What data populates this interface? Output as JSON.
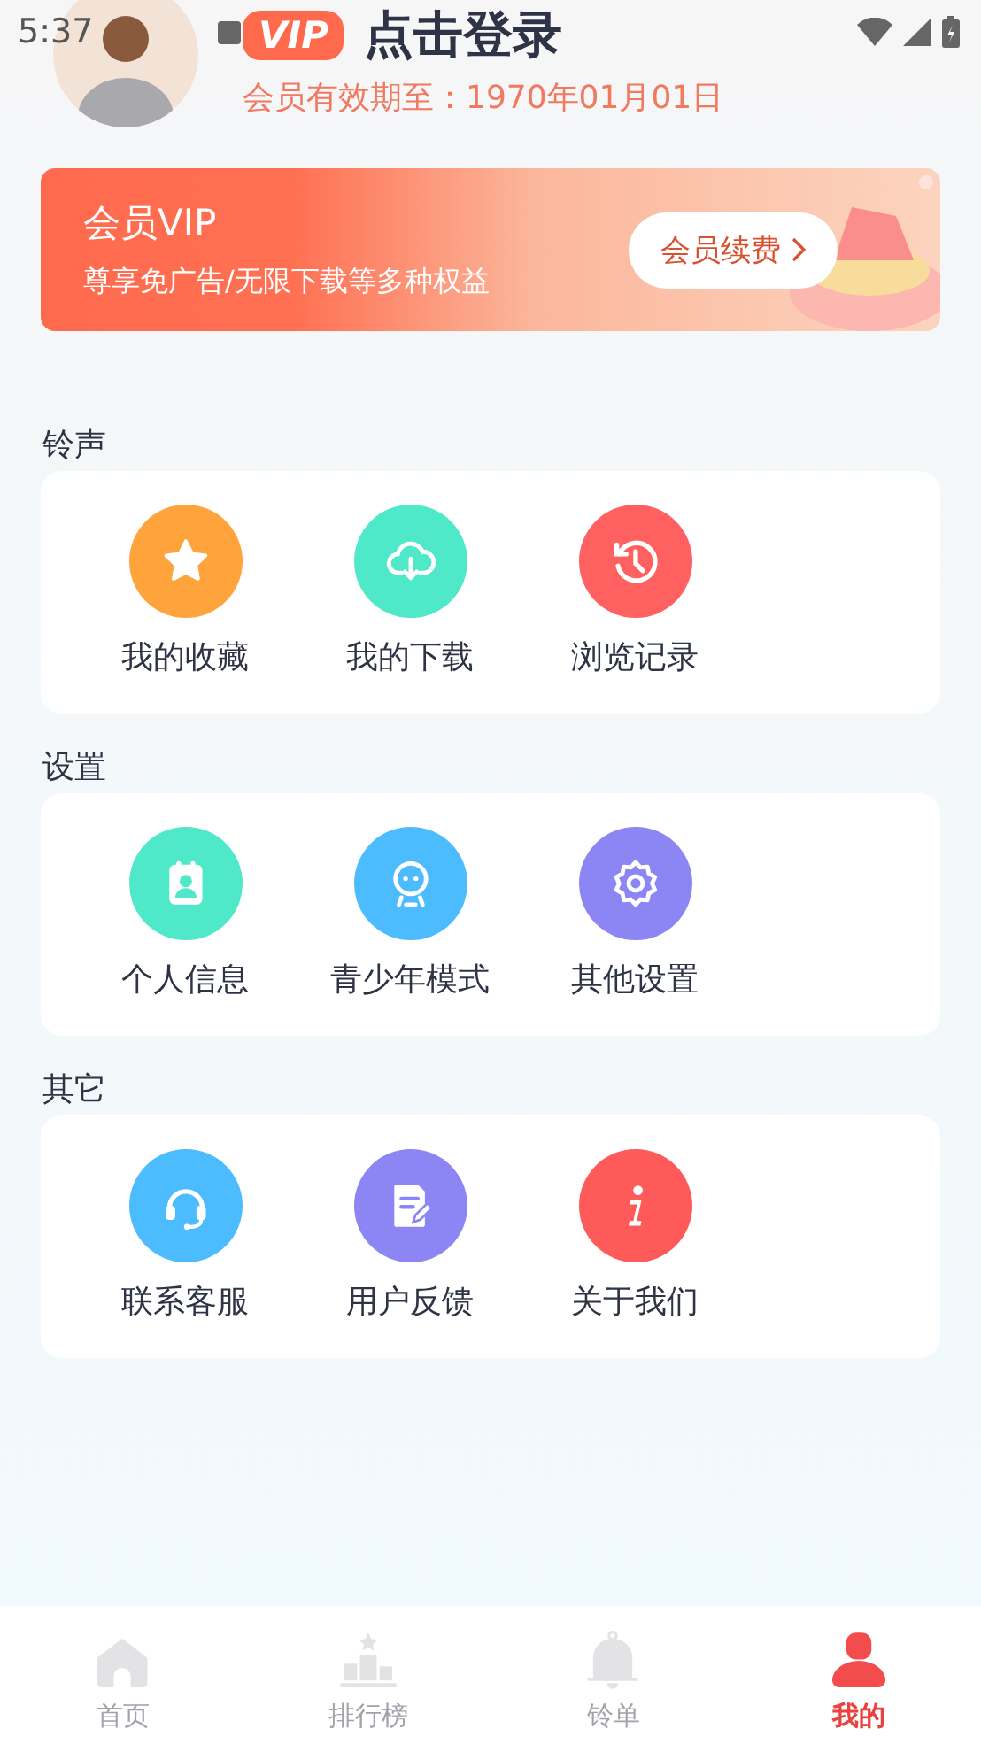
{
  "status_bar": {
    "time": "5:37"
  },
  "profile": {
    "vip_badge": "VIP",
    "title": "点击登录",
    "expiry": "会员有效期至：1970年01月01日"
  },
  "vip_banner": {
    "title": "会员VIP",
    "subtitle": "尊享免广告/无限下载等多种权益",
    "button": "会员续费"
  },
  "sections": [
    {
      "title": "铃声",
      "items": [
        {
          "label": "我的收藏",
          "kind": "star",
          "color": "#ffa43d"
        },
        {
          "label": "我的下载",
          "kind": "download",
          "color": "#4fe8c8"
        },
        {
          "label": "浏览记录",
          "kind": "history",
          "color": "#ff6060"
        }
      ]
    },
    {
      "title": "设置",
      "items": [
        {
          "label": "个人信息",
          "kind": "contact",
          "color": "#4fe8c8"
        },
        {
          "label": "青少年模式",
          "kind": "face",
          "color": "#4cbcff"
        },
        {
          "label": "其他设置",
          "kind": "gear",
          "color": "#8c86f5"
        }
      ]
    },
    {
      "title": "其它",
      "items": [
        {
          "label": "联系客服",
          "kind": "headset",
          "color": "#4cbcff"
        },
        {
          "label": "用户反馈",
          "kind": "feedback",
          "color": "#8c86f5"
        },
        {
          "label": "关于我们",
          "kind": "info",
          "color": "#ff5a5a"
        }
      ]
    }
  ],
  "bottom_nav": [
    {
      "label": "首页",
      "kind": "home",
      "selected": false
    },
    {
      "label": "排行榜",
      "kind": "podium",
      "selected": false
    },
    {
      "label": "铃单",
      "kind": "bell",
      "selected": false
    },
    {
      "label": "我的",
      "kind": "person",
      "selected": true
    }
  ]
}
